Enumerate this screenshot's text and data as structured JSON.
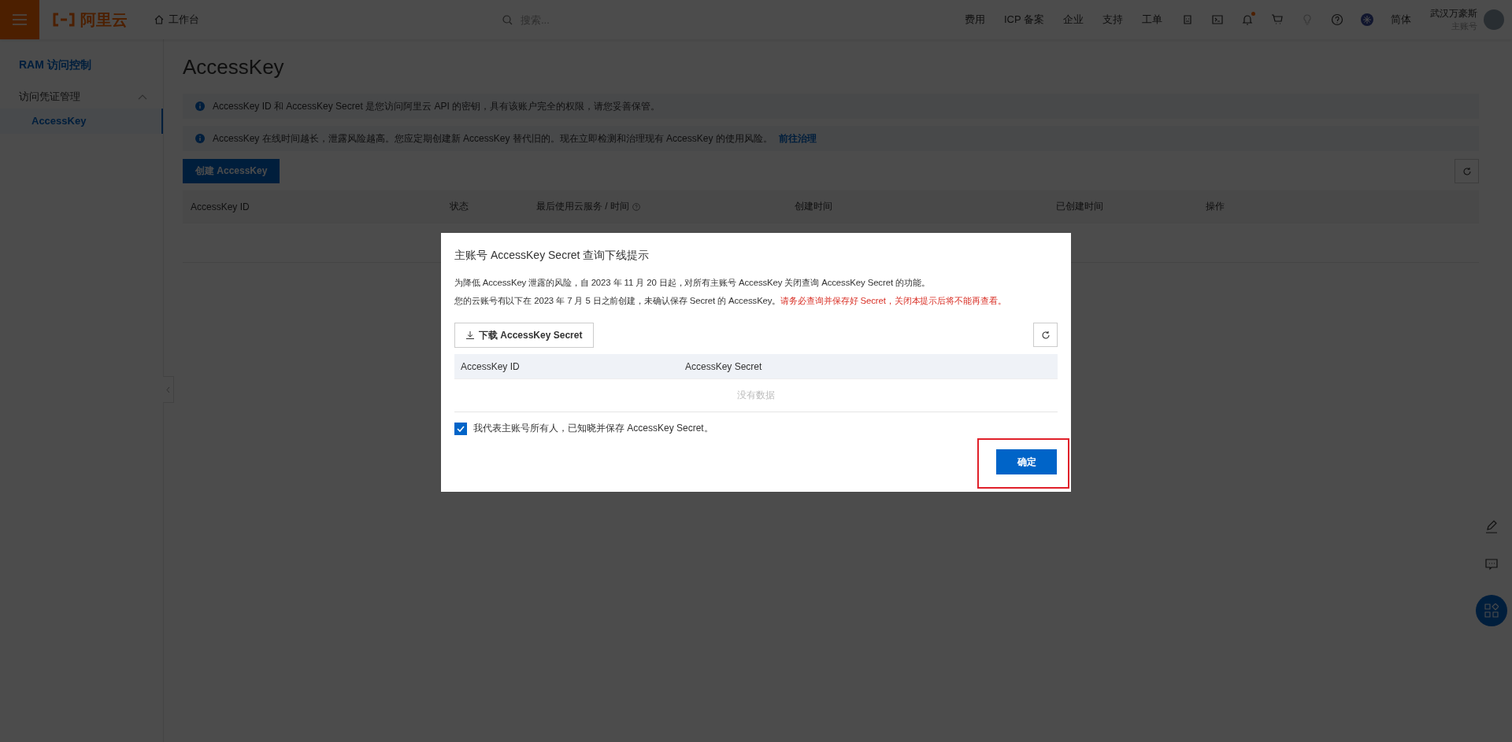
{
  "topbar": {
    "logo": "阿里云",
    "breadcrumb": "工作台",
    "search": {
      "placeholder": "搜索..."
    },
    "nav": [
      "费用",
      "ICP 备案",
      "企业",
      "支持",
      "工单"
    ],
    "bell": {
      "unread": true
    },
    "language": "简体",
    "user": {
      "name": "武汉万豪斯",
      "role": "主账号"
    }
  },
  "sidebar": {
    "title": "RAM 访问控制",
    "groups": [
      {
        "label": "访问凭证管理",
        "expanded": true,
        "children": [
          {
            "label": "AccessKey",
            "selected": true
          }
        ]
      }
    ]
  },
  "main": {
    "title": "AccessKey",
    "alerts": [
      {
        "text": "AccessKey ID 和 AccessKey Secret 是您访问阿里云 API 的密钥，具有该账户完全的权限，请您妥善保管。"
      },
      {
        "text": "AccessKey 在线时间越长，泄露风险越高。您应定期创建新 AccessKey 替代旧的。现在立即检测和治理现有 AccessKey 的使用风险。",
        "link": "前往治理"
      }
    ],
    "create_button": "创建 AccessKey",
    "table": {
      "columns": [
        {
          "label": "AccessKey ID",
          "help": false
        },
        {
          "label": "状态",
          "help": false
        },
        {
          "label": "最后使用云服务 / 时间",
          "help": true
        },
        {
          "label": "创建时间",
          "help": false
        },
        {
          "label": "已创建时间",
          "help": false
        },
        {
          "label": "操作",
          "help": false
        }
      ]
    }
  },
  "modal": {
    "title": "主账号 AccessKey Secret 查询下线提示",
    "paragraphs": [
      {
        "text": "为降低 AccessKey 泄露的风险，自 2023 年 11 月 20 日起，对所有主账号 AccessKey 关闭查询 AccessKey Secret 的功能。"
      },
      {
        "text": "您的云账号有以下在 2023 年 7 月 5 日之前创建，未确认保存 Secret 的 AccessKey。",
        "warning": "请务必查询并保存好 Secret，关闭本提示后将不能再查看。"
      }
    ],
    "download_button": "下载 AccessKey Secret",
    "table": {
      "columns": [
        "AccessKey ID",
        "AccessKey Secret"
      ],
      "empty_text": "没有数据"
    },
    "consent": {
      "label": "我代表主账号所有人，已知晓并保存 AccessKey Secret。",
      "checked": true
    },
    "confirm_button": "确定"
  }
}
